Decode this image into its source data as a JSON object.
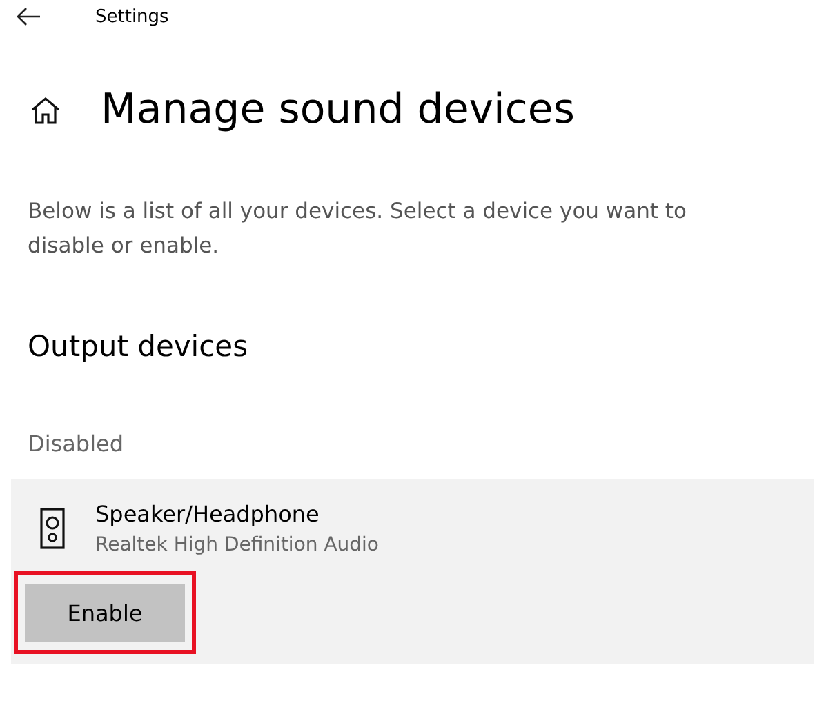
{
  "window": {
    "title": "Settings"
  },
  "page": {
    "title": "Manage sound devices",
    "description": "Below is a list of all your devices. Select a device you want to disable or enable."
  },
  "sections": [
    {
      "heading": "Output devices",
      "groups": [
        {
          "label": "Disabled",
          "devices": [
            {
              "name": "Speaker/Headphone",
              "driver": "Realtek High Definition Audio",
              "button": {
                "label": "Enable",
                "highlighted": true
              }
            }
          ]
        }
      ]
    }
  ]
}
